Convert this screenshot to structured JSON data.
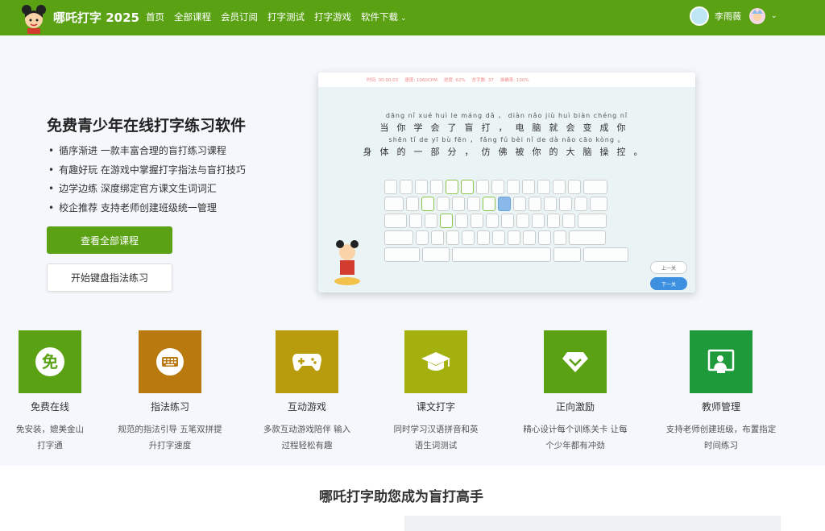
{
  "nav": {
    "brand": "哪吒打字 2025",
    "items": [
      "首页",
      "全部课程",
      "会员订阅",
      "打字测试",
      "打字游戏",
      "软件下载"
    ],
    "user_name": "李雨薇",
    "bg_color": "#5aa114"
  },
  "hero": {
    "title": "免费青少年在线打字练习软件",
    "bullets": [
      "循序渐进 一款丰富合理的盲打练习课程",
      "有趣好玩 在游戏中掌握打字指法与盲打技巧",
      "边学边练 深度绑定官方课文生词词汇",
      "校企推荐 支持老师创建班级统一管理"
    ],
    "primary_button": "查看全部课程",
    "secondary_button": "开始键盘指法练习"
  },
  "preview": {
    "stats": [
      "时间: 00:00:03",
      "速度: 1060CPM",
      "进度: 62%",
      "总字数: 37",
      "准确率: 100%"
    ],
    "pinyin1": "dāng nǐ xué huì le máng dǎ ， diàn nǎo jiù huì biàn chéng nǐ",
    "han1": "当你学会了盲打，电脑就会变成你",
    "pinyin2": "shēn tǐ de yī bù fēn ， fǎng fú bèi nǐ de dà nǎo cāo kòng 。",
    "han2": "身体的一部分，仿佛被你的大脑操控。",
    "prev": "上一关",
    "next": "下一关"
  },
  "features": [
    {
      "title": "免费在线",
      "desc": "免安装，媲美金山打字通",
      "icon": "free-icon",
      "color": "#5aa114"
    },
    {
      "title": "指法练习",
      "desc": "规范的指法引导 五笔双拼提升打字速度",
      "icon": "keyboard-icon",
      "color": "#b8790e"
    },
    {
      "title": "互动游戏",
      "desc": "多款互动游戏陪伴 输入过程轻松有趣",
      "icon": "gamepad-icon",
      "color": "#b89c0e"
    },
    {
      "title": "课文打字",
      "desc": "同时学习汉语拼音和英语生词测试",
      "icon": "graduation-cap-icon",
      "color": "#a4b00e"
    },
    {
      "title": "正向激励",
      "desc": "精心设计每个训练关卡 让每个少年都有冲劲",
      "icon": "diamond-icon",
      "color": "#5aa114"
    },
    {
      "title": "教师管理",
      "desc": "支持老师创建班级，布置指定时间练习",
      "icon": "teacher-icon",
      "color": "#1f9a3a"
    }
  ],
  "bottom": {
    "title": "哪吒打字助您成为盲打高手"
  }
}
